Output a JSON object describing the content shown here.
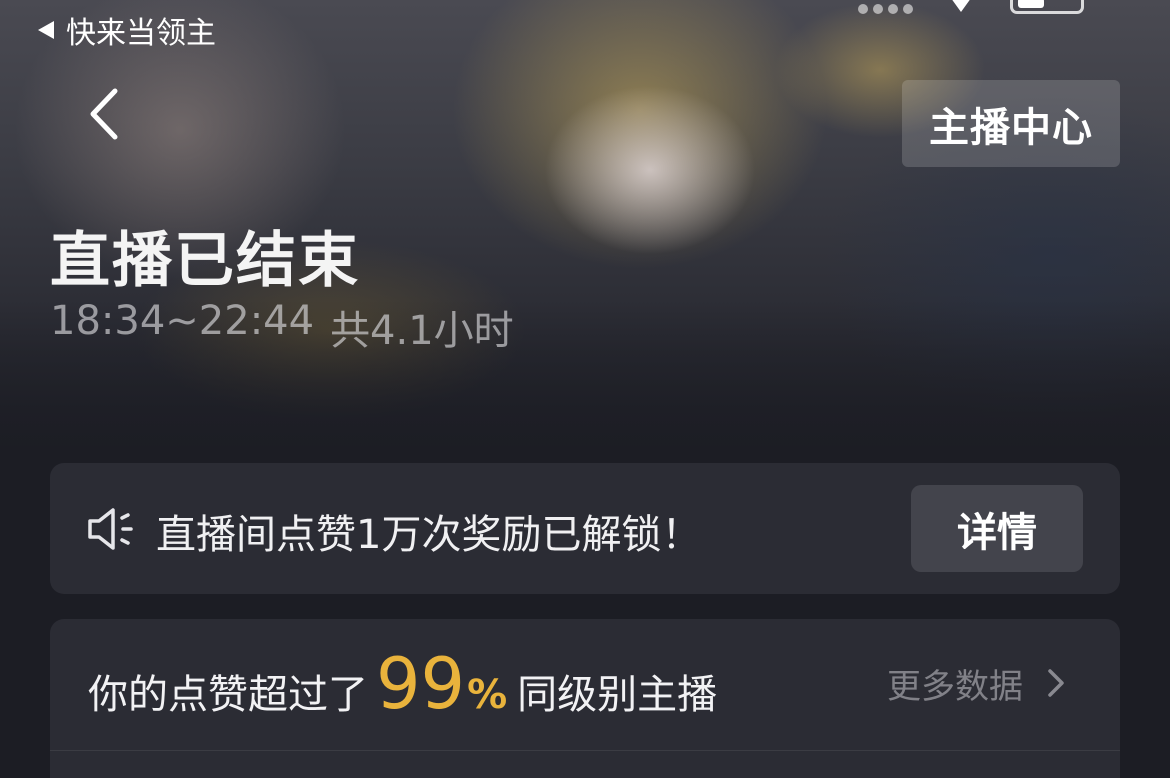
{
  "status_bar": {
    "back_app_label": "快来当领主",
    "icons": [
      "back-triangle-icon",
      "signal-icon",
      "wifi-icon",
      "battery-icon"
    ]
  },
  "header": {
    "back_icon": "chevron-left-icon",
    "anchor_center_label": "主播中心"
  },
  "live_summary": {
    "title": "直播已结束",
    "time_range": "18:34~22:44",
    "duration": "共4.1小时"
  },
  "notice": {
    "icon": "speaker-icon",
    "text": "直播间点赞1万次奖励已解锁！",
    "detail_button_label": "详情"
  },
  "stats": {
    "prefix": "你的点赞超过了",
    "percent_value": "99",
    "percent_sign": "%",
    "suffix": "同级别主播",
    "more_data_label": "更多数据",
    "more_icon": "chevron-right-icon"
  },
  "colors": {
    "accent": "#e9b33c",
    "card_background": "#2b2c34",
    "page_background": "#1c1d24",
    "button_background": "#43444c"
  }
}
